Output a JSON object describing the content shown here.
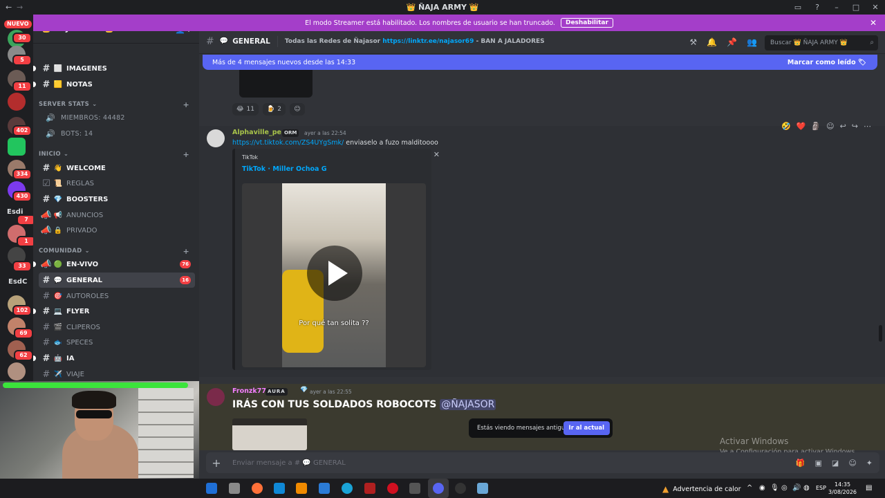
{
  "window": {
    "title": "👑 ÑAJA ARMY 👑",
    "back": "←",
    "forward": "→"
  },
  "streamer_bar": {
    "text": "El modo Streamer está habilitado. Los nombres de usuario se han truncado.",
    "button": "Deshabilitar"
  },
  "guild_rail": {
    "new_label": "NUEVO",
    "badges": [
      "30",
      "5",
      "11",
      "402",
      "334",
      "430",
      "7",
      "1",
      "33",
      "102",
      "69",
      "62"
    ],
    "text_items": [
      "Esdi",
      "EsdC"
    ]
  },
  "server": {
    "name": "👑 ÑAJA ARMY 👑",
    "top_channels": [
      {
        "emoji": "⬜",
        "name": "IMAGENES",
        "bright": true
      },
      {
        "emoji": "🟨",
        "name": "NOTAS",
        "bright": true
      }
    ],
    "stats_category": "SERVER STATS",
    "stats": [
      {
        "label": "MIEMBROS: 44482"
      },
      {
        "label": "BOTS: 14"
      }
    ],
    "inicio_category": "INICIO",
    "inicio_channels": [
      {
        "emoji": "👋",
        "name": "WELCOME",
        "bright": true
      },
      {
        "emoji": "📜",
        "name": "REGLAS",
        "bright": false
      },
      {
        "emoji": "💎",
        "name": "BOOSTERS",
        "bright": true
      },
      {
        "emoji": "📢",
        "name": "ANUNCIOS",
        "bright": false
      },
      {
        "emoji": "🔒",
        "name": "PRIVADO",
        "bright": false
      }
    ],
    "comunidad_category": "COMUNIDAD",
    "comunidad_channels": [
      {
        "emoji": "🟢",
        "name": "EN-VIVO",
        "bright": true,
        "badge": "76"
      },
      {
        "emoji": "💬",
        "name": "GENERAL",
        "bright": true,
        "selected": true,
        "badge": "16"
      },
      {
        "emoji": "🎯",
        "name": "AUTOROLES",
        "bright": false
      },
      {
        "emoji": "💻",
        "name": "FLYER",
        "bright": true
      },
      {
        "emoji": "🎬",
        "name": "CLIPEROS",
        "bright": false
      },
      {
        "emoji": "🐟",
        "name": "SPECES",
        "bright": false
      },
      {
        "emoji": "🤖",
        "name": "IA",
        "bright": true
      },
      {
        "emoji": "✈️",
        "name": "VIAJE",
        "bright": false
      }
    ]
  },
  "chat_header": {
    "channel": "GENERAL",
    "topic_prefix": "Todas las Redes de Ñajasor",
    "topic_link": "https://linktr.ee/najasor69",
    "topic_suffix": "- BAN A JALADORES",
    "search_placeholder": "Buscar 👑 ÑAJA ARMY 👑"
  },
  "new_messages_bar": {
    "text": "Más de 4 mensajes nuevos desde las 14:33",
    "mark_read": "Marcar como leído"
  },
  "reactions": [
    {
      "emoji": "😂",
      "count": "11"
    },
    {
      "emoji": "🍺",
      "count": "2"
    }
  ],
  "message1": {
    "author": "Alphaville_pe",
    "author_color": "#a8c34a",
    "tag": "ORM",
    "timestamp": "ayer a las 22:54",
    "link": "https://vt.tiktok.com/ZS4UYgSmk/",
    "text": "enviaselo a fuzo malditoooo",
    "embed_provider": "TikTok",
    "embed_title": "TikTok · Miller Ochoa G",
    "video_caption": "Por qué tan solita ??"
  },
  "message2": {
    "author": "Fronzk77",
    "author_color": "#f47fff",
    "tag": "AURA",
    "timestamp": "ayer a las 22:55",
    "text": "IRÁS CON TUS SOLDADOS ROBOCOTS",
    "mention": "@ÑAJASOR"
  },
  "old_messages_bar": {
    "text": "Estás viendo mensajes antiguos",
    "button": "Ir al actual"
  },
  "composer": {
    "placeholder": "Enviar mensaje a # 💬 GENERAL"
  },
  "watermark": {
    "title": "Activar Windows",
    "subtitle": "Ve a Configuración para activar Windows."
  },
  "taskbar": {
    "heat_warning": "Advertencia de calor",
    "language": "ESP",
    "time": "14:35",
    "date": "3/08/2026"
  }
}
